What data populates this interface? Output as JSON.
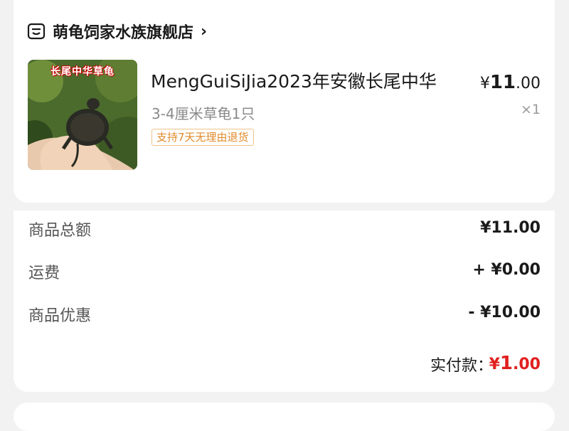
{
  "shop": {
    "name": "萌龟饲家水族旗舰店",
    "chevron": "›",
    "icon": "store-icon"
  },
  "product": {
    "title": "MengGuiSiJia2023年安徽长尾中华",
    "spec": "3-4厘米草龟1只",
    "tag": "支持7天无理由退货",
    "image_label": "长尾中华草龟",
    "price_symbol": "¥",
    "price_int": "11",
    "price_dec": ".00",
    "quantity": "×1"
  },
  "summary": {
    "rows": [
      {
        "label": "商品总额",
        "value": "¥11.00"
      },
      {
        "label": "运费",
        "value": "+ ¥0.00"
      },
      {
        "label": "商品优惠",
        "value": "- ¥10.00"
      }
    ],
    "paid_label": "实付款：",
    "paid_symbol": "¥",
    "paid_int": "1",
    "paid_dec": ".00"
  },
  "colors": {
    "accent_red": "#e0201f",
    "tag_orange": "#e08a2a",
    "background": "#f2f2f2"
  }
}
